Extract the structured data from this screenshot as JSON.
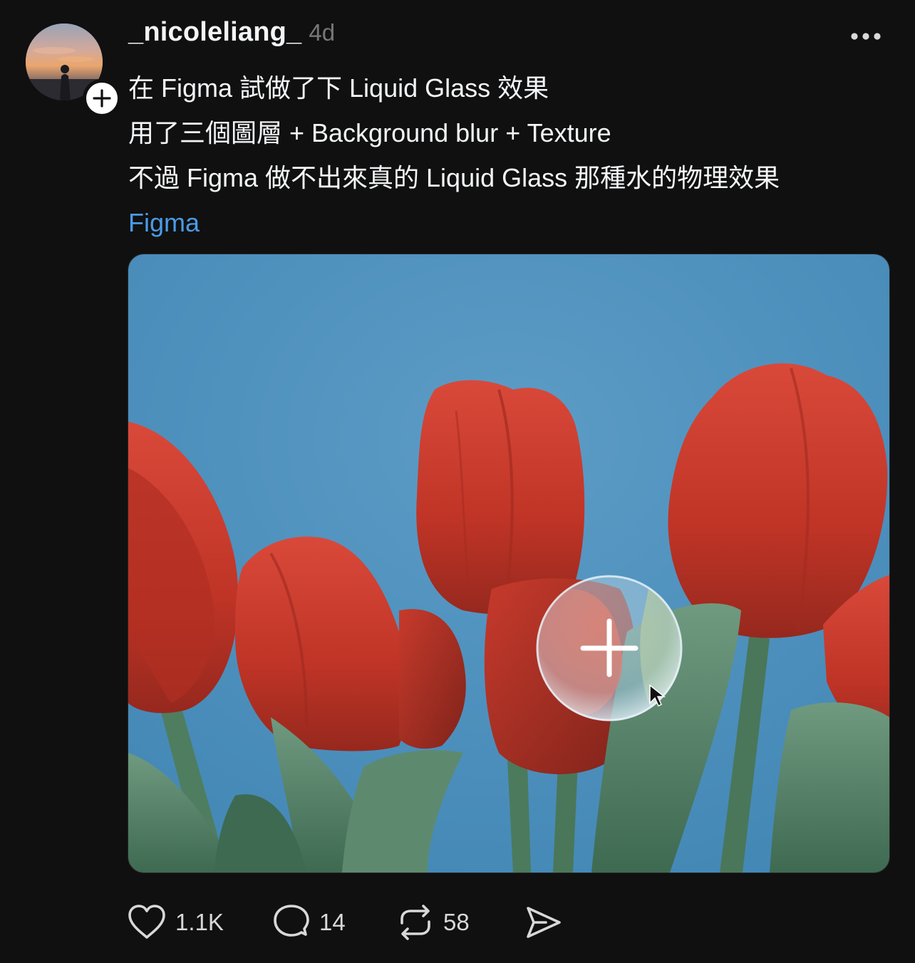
{
  "post": {
    "author": {
      "username": "_nicoleliang_",
      "avatar_icon": "avatar-photo",
      "follow_icon": "plus-icon"
    },
    "timestamp": "4d",
    "more_icon": "more-horizontal-icon",
    "text_lines": [
      "在 Figma 試做了下 Liquid Glass 效果",
      "用了三個圖層 + Background blur + Texture",
      "不過 Figma 做不出來真的 Liquid Glass 那種水的物理效果"
    ],
    "topic_tag": "Figma",
    "image": {
      "alt_icon": "tulip-photo-with-liquid-glass-button"
    }
  },
  "actions": {
    "like": {
      "icon": "heart-icon",
      "count": "1.1K"
    },
    "reply": {
      "icon": "comment-icon",
      "count": "14"
    },
    "repost": {
      "icon": "repost-icon",
      "count": "58"
    },
    "share": {
      "icon": "send-icon"
    }
  },
  "colors": {
    "background": "#101010",
    "text": "#f3f5f7",
    "muted": "#777777",
    "link": "#4a9be8",
    "sky": "#4f92bf",
    "tulip": "#c8392b",
    "stem": "#4f7d5f"
  }
}
